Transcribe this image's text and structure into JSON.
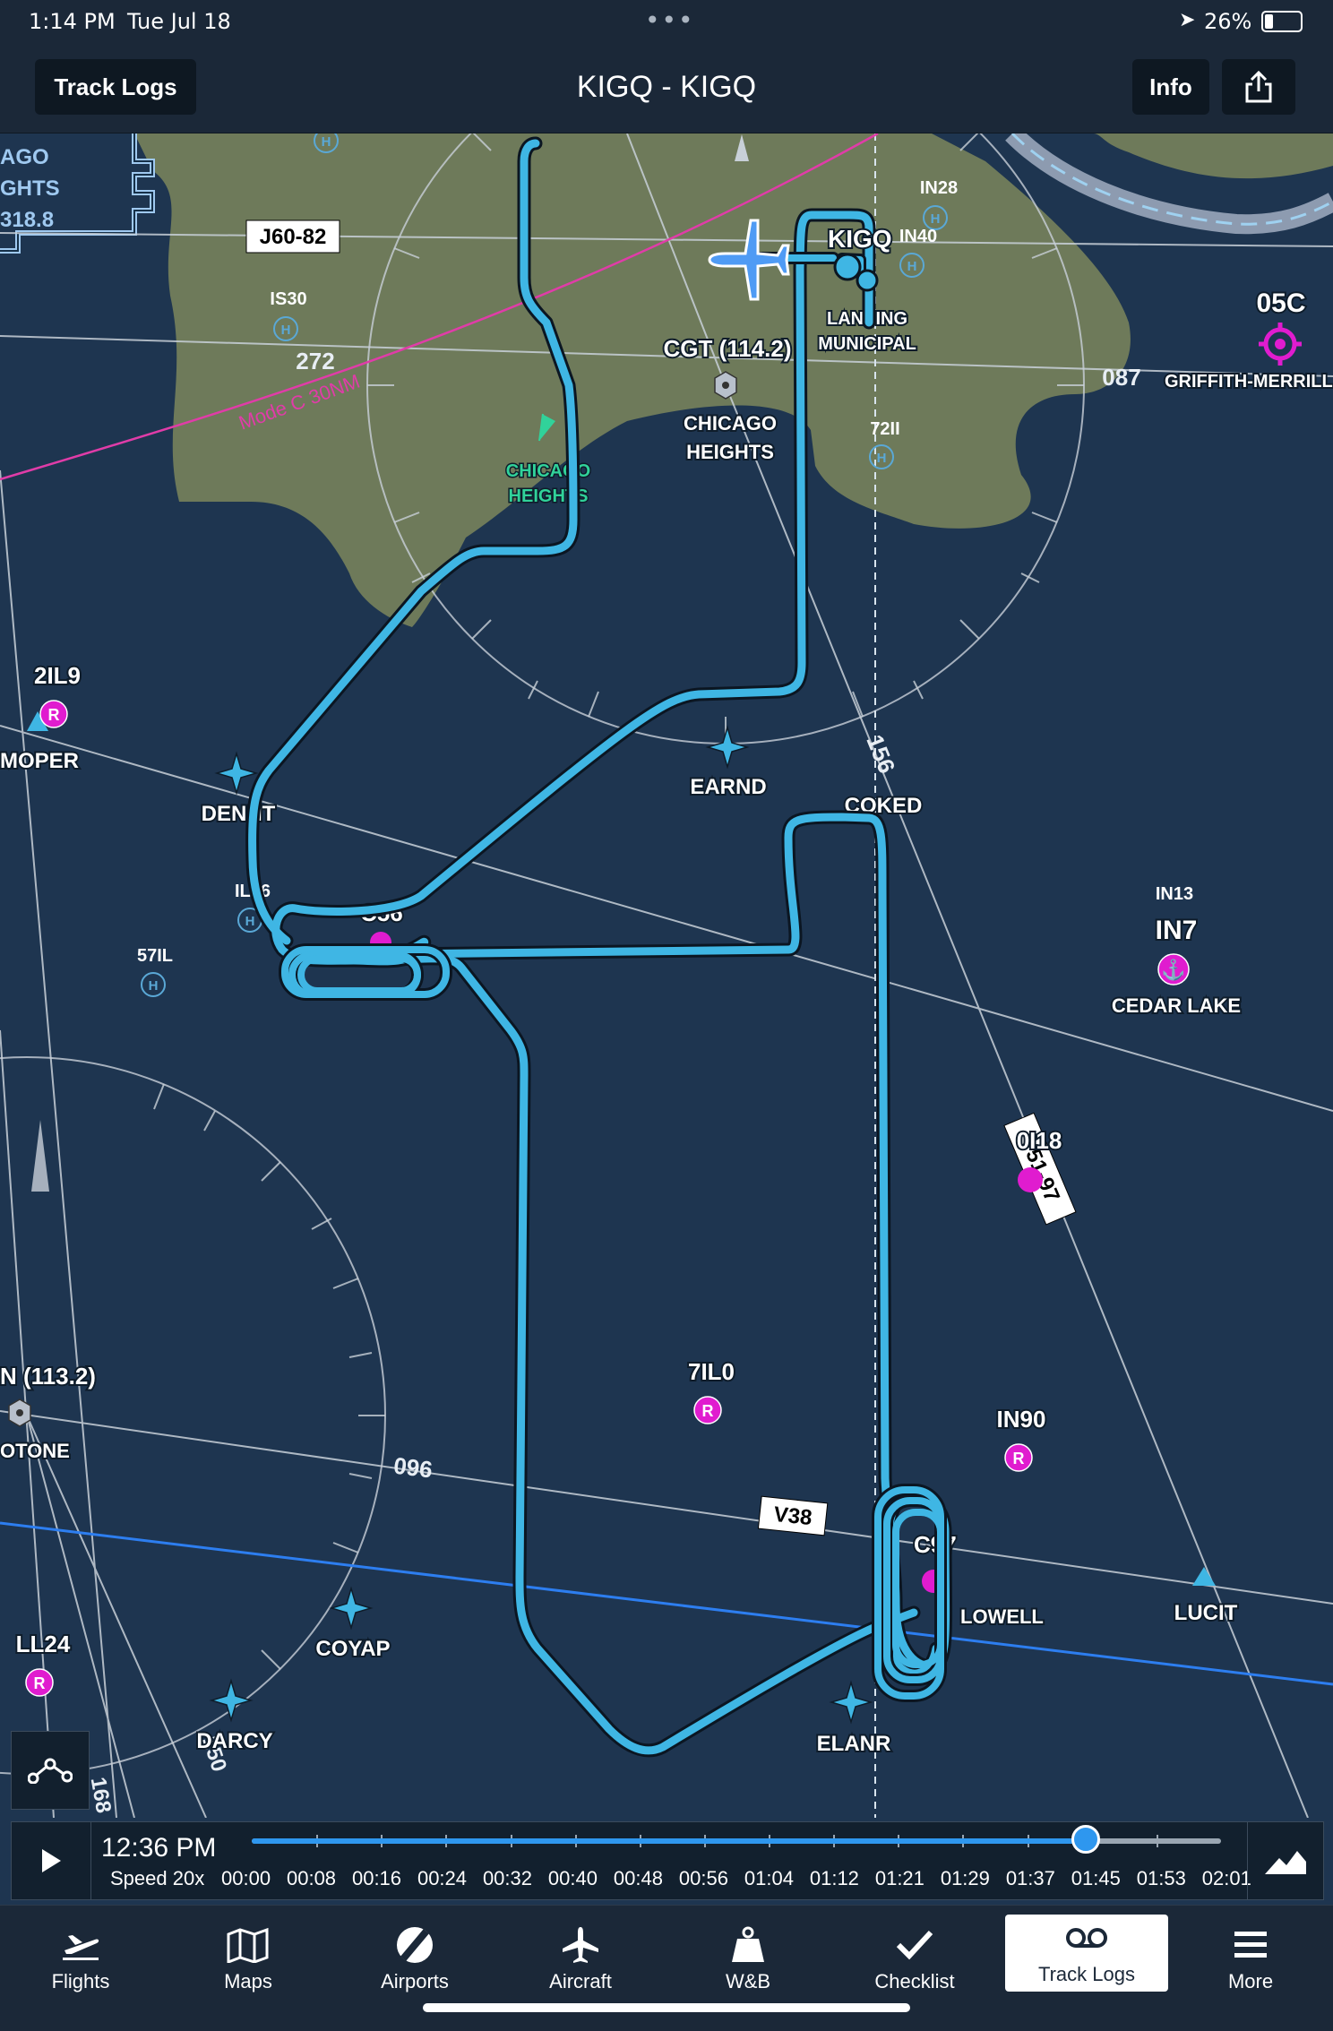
{
  "status_bar": {
    "time": "1:14 PM",
    "date": "Tue Jul 18",
    "battery": "26%"
  },
  "header": {
    "title": "KIGQ - KIGQ",
    "back_label": "Track Logs",
    "info_label": "Info"
  },
  "map": {
    "airways": [
      "J60-82",
      "V38",
      "V51-97"
    ],
    "airspace": "Mode C 30NM",
    "radials": [
      "272",
      "087",
      "156",
      "096",
      "150",
      "168"
    ],
    "vors": [
      "CGT (114.2)",
      "N (113.2)"
    ],
    "vor_names": [
      "CHICAGO HEIGHTS",
      "OTONE"
    ],
    "airports": [
      {
        "id": "KIGQ",
        "name": "LANSING MUNICIPAL"
      },
      {
        "id": "05C",
        "name": "GRIFFITH-MERRILL"
      },
      {
        "id": "IN7",
        "name": "CEDAR LAKE"
      },
      {
        "id": "2IL9"
      },
      {
        "id": "7IL0"
      },
      {
        "id": "IN90"
      },
      {
        "id": "LL24"
      },
      {
        "id": "0I18"
      },
      {
        "id": "C56"
      },
      {
        "id": "C97",
        "name": "LOWELL"
      }
    ],
    "heliports": [
      "IN28",
      "IN40",
      "IS30",
      "72II",
      "IL96",
      "57IL",
      "IN13"
    ],
    "fixes": [
      "MOPER",
      "DENNT",
      "EARND",
      "COKED",
      "COYAP",
      "DARCY",
      "ELANR",
      "LUCIT"
    ],
    "places": [
      "CHICAGO HEIGHTS"
    ],
    "chicago_label": [
      "AGO",
      "GHTS",
      "318.8"
    ],
    "track_color": "#3fb6e4"
  },
  "playback": {
    "time": "12:36 PM",
    "speed": "Speed 20x",
    "ticks": [
      "00:00",
      "00:08",
      "00:16",
      "00:24",
      "00:32",
      "00:40",
      "00:48",
      "00:56",
      "01:04",
      "01:12",
      "01:21",
      "01:29",
      "01:37",
      "01:45",
      "01:53",
      "02:01"
    ],
    "progress": 0.86
  },
  "tabs": [
    {
      "label": "Flights",
      "icon": "airplane-takeoff-icon"
    },
    {
      "label": "Maps",
      "icon": "map-icon"
    },
    {
      "label": "Airports",
      "icon": "airport-icon"
    },
    {
      "label": "Aircraft",
      "icon": "airplane-icon"
    },
    {
      "label": "W&B",
      "icon": "weight-icon"
    },
    {
      "label": "Checklist",
      "icon": "checkmark-icon"
    },
    {
      "label": "Track Logs",
      "icon": "track-logs-icon",
      "active": true
    },
    {
      "label": "More",
      "icon": "menu-icon"
    }
  ]
}
